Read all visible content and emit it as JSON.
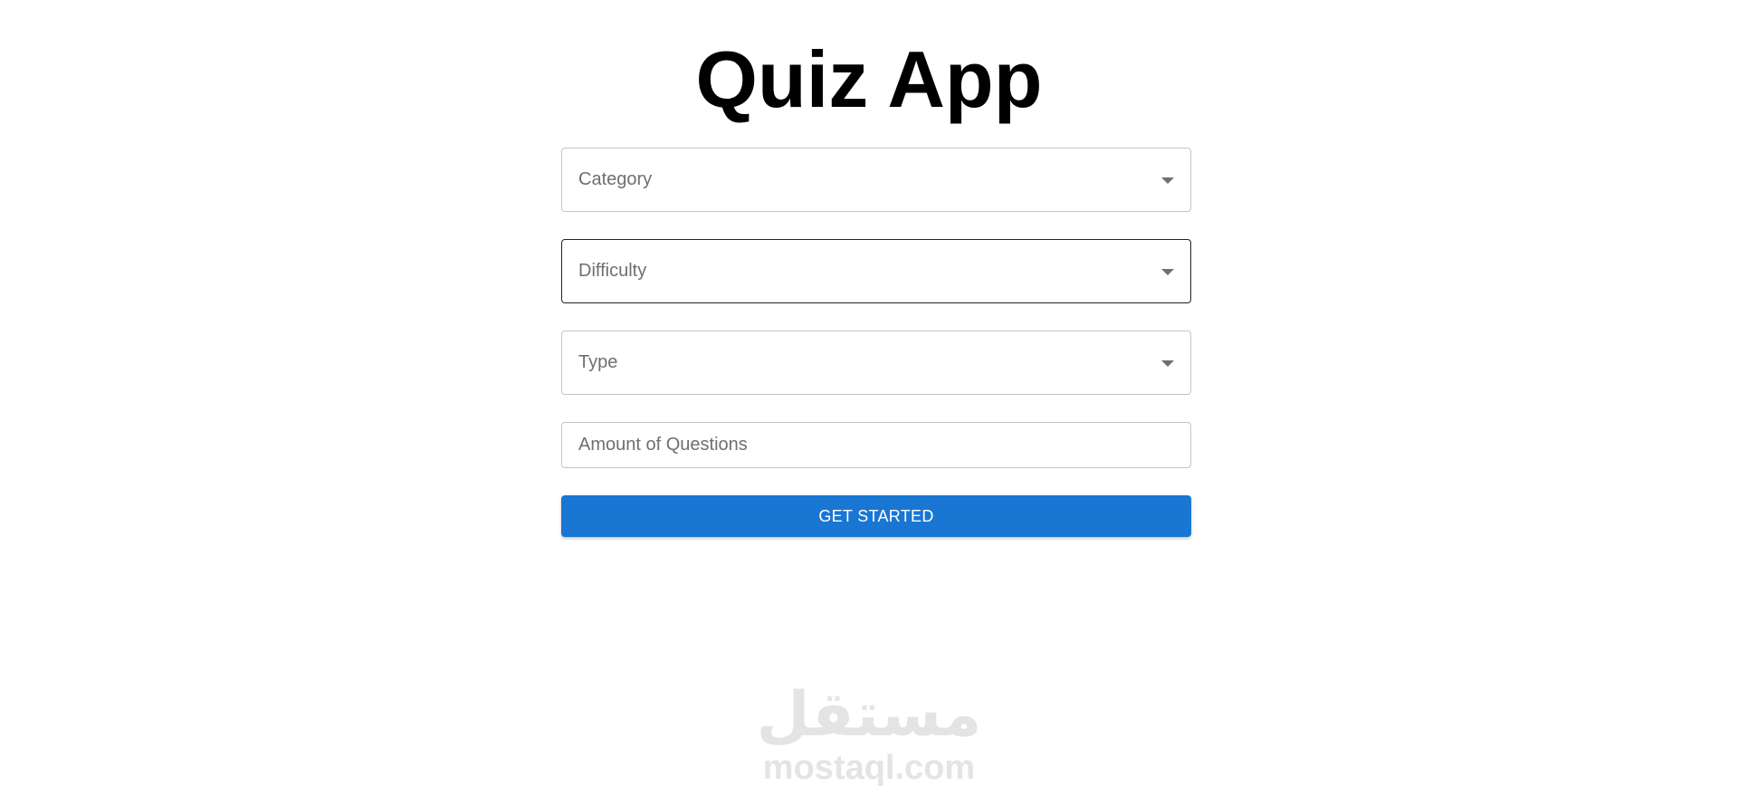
{
  "header": {
    "title": "Quiz App"
  },
  "form": {
    "category": {
      "label": "Category",
      "icon": "chevron-down-icon"
    },
    "difficulty": {
      "label": "Difficulty",
      "icon": "chevron-down-icon"
    },
    "type": {
      "label": "Type",
      "icon": "chevron-down-icon"
    },
    "amount": {
      "placeholder": "Amount of Questions",
      "value": ""
    },
    "start_button": {
      "label": "GET STARTED"
    }
  },
  "watermark": {
    "logo_text": "مستقل",
    "site": "mostaql.com"
  },
  "colors": {
    "primary": "#1976d2",
    "border": "#c4c4c4",
    "focused_border": "#222222",
    "label": "#6f6f6f",
    "watermark": "#e4e4e4"
  }
}
